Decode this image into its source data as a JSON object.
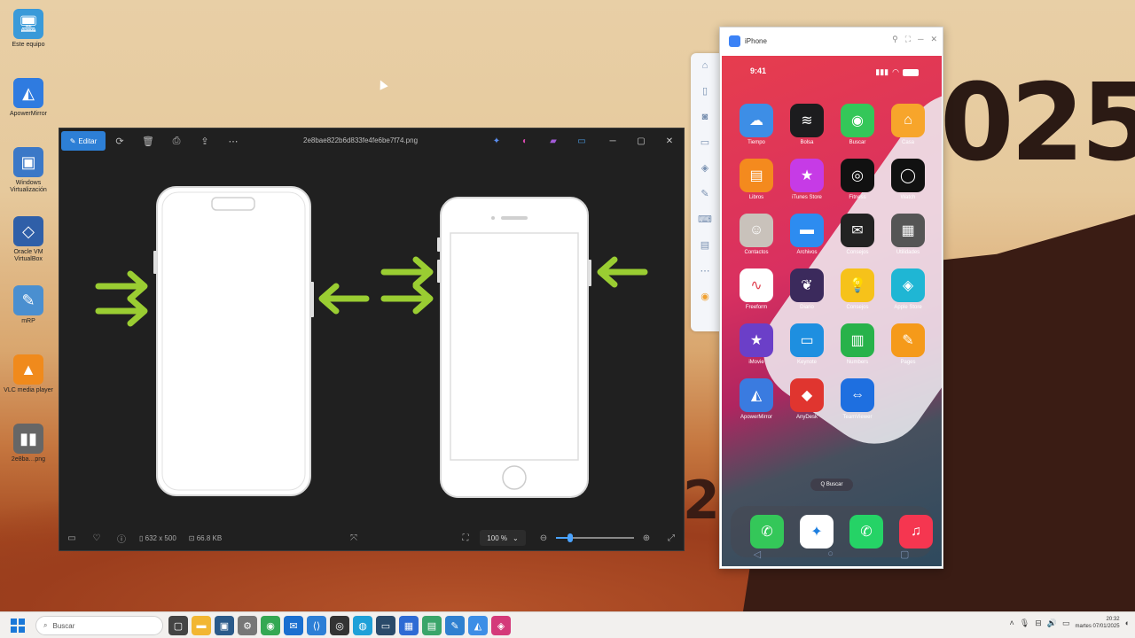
{
  "desktop": {
    "year_text": "025",
    "year_bottom": "2",
    "icons": [
      {
        "label": "Este equipo",
        "glyph": "🖥",
        "color": "#3a9ad9"
      },
      {
        "label": "ApowerMirror",
        "glyph": "◭",
        "color": "#2f7be0"
      },
      {
        "label": "Windows Virtualización",
        "glyph": "▣",
        "color": "#3b78c7"
      },
      {
        "label": "Oracle VM VirtualBox",
        "glyph": "◇",
        "color": "#2f5fa8"
      },
      {
        "label": "mRP",
        "glyph": "✎",
        "color": "#4a8fd0"
      },
      {
        "label": "VLC media player",
        "glyph": "▲",
        "color": "#f08a1c"
      },
      {
        "label": "2e8ba…png",
        "glyph": "▮▮",
        "color": "#666666"
      }
    ]
  },
  "photos": {
    "edit_label": "Editar",
    "filename": "2e8bae822b6d833fe4fe6be7f74.png",
    "status_dims": "632 x 500",
    "status_size": "66.8 KB",
    "zoom": "100 %",
    "zoom_fraction": 0.18
  },
  "mirror": {
    "title": "iPhone",
    "time": "9:41",
    "search": "Q Buscar",
    "apps": [
      {
        "label": "Tiempo",
        "glyph": "☁",
        "color": "#3d8ee6"
      },
      {
        "label": "Bolsa",
        "glyph": "≋",
        "color": "#1c1c1e"
      },
      {
        "label": "Buscar",
        "glyph": "◉",
        "color": "#34c759"
      },
      {
        "label": "Casa",
        "glyph": "⌂",
        "color": "#f7a52b"
      },
      {
        "label": "Libros",
        "glyph": "▤",
        "color": "#f48a1e"
      },
      {
        "label": "iTunes Store",
        "glyph": "★",
        "color": "#c63be6"
      },
      {
        "label": "Fitness",
        "glyph": "◎",
        "color": "#111111"
      },
      {
        "label": "Watch",
        "glyph": "◯",
        "color": "#111111"
      },
      {
        "label": "Contactos",
        "glyph": "☺",
        "color": "#c9c2bb"
      },
      {
        "label": "Archivos",
        "glyph": "▬",
        "color": "#2d8cf0"
      },
      {
        "label": "Consejos",
        "glyph": "✉",
        "color": "#222222"
      },
      {
        "label": "Utilidades",
        "glyph": "▦",
        "color": "#555555"
      },
      {
        "label": "Freeform",
        "glyph": "∿",
        "color": "#ffffff"
      },
      {
        "label": "Diario",
        "glyph": "❦",
        "color": "#3b2a5c"
      },
      {
        "label": "Consejos",
        "glyph": "💡",
        "color": "#f6c21a"
      },
      {
        "label": "Apple Store",
        "glyph": "◈",
        "color": "#1fb6d4"
      },
      {
        "label": "iMovie",
        "glyph": "★",
        "color": "#6b3fc8"
      },
      {
        "label": "Keynote",
        "glyph": "▭",
        "color": "#1e8fe0"
      },
      {
        "label": "Numbers",
        "glyph": "▥",
        "color": "#28b24a"
      },
      {
        "label": "Pages",
        "glyph": "✎",
        "color": "#f59a1a"
      },
      {
        "label": "ApowerMirror",
        "glyph": "◭",
        "color": "#3a7be0"
      },
      {
        "label": "AnyDesk",
        "glyph": "◆",
        "color": "#e0352f"
      },
      {
        "label": "TeamViewer",
        "glyph": "⇔",
        "color": "#1e6fe0"
      }
    ],
    "dock": [
      {
        "label": "Teléfono",
        "glyph": "✆",
        "color": "#34c759"
      },
      {
        "label": "Safari",
        "glyph": "✦",
        "color": "#ffffff"
      },
      {
        "label": "WhatsApp",
        "glyph": "✆",
        "color": "#25d366"
      },
      {
        "label": "Música",
        "glyph": "♫",
        "color": "#f53650"
      }
    ]
  },
  "taskbar": {
    "search_placeholder": "Buscar",
    "time": "20:32",
    "date": "martes 07/01/2025",
    "apps": [
      {
        "name": "task-view",
        "glyph": "▢",
        "color": "#444444"
      },
      {
        "name": "file-explorer",
        "glyph": "▬",
        "color": "#f2b632"
      },
      {
        "name": "terminal",
        "glyph": "▣",
        "color": "#2a5a8a"
      },
      {
        "name": "settings",
        "glyph": "⚙",
        "color": "#777777"
      },
      {
        "name": "chrome",
        "glyph": "◉",
        "color": "#34a853"
      },
      {
        "name": "outlook",
        "glyph": "✉",
        "color": "#1a6fd0"
      },
      {
        "name": "vscode",
        "glyph": "⟨⟩",
        "color": "#2d7fd6"
      },
      {
        "name": "obs",
        "glyph": "◎",
        "color": "#333333"
      },
      {
        "name": "edge",
        "glyph": "◍",
        "color": "#1ea0d8"
      },
      {
        "name": "monitor",
        "glyph": "▭",
        "color": "#2a4a6a"
      },
      {
        "name": "app-grid",
        "glyph": "▦",
        "color": "#2e6bd4"
      },
      {
        "name": "notes",
        "glyph": "▤",
        "color": "#3aa56a"
      },
      {
        "name": "paint",
        "glyph": "✎",
        "color": "#2f80d0"
      },
      {
        "name": "apowermirror",
        "glyph": "◭",
        "color": "#3d8ee6"
      },
      {
        "name": "photos",
        "glyph": "◈",
        "color": "#d43a7a"
      }
    ]
  }
}
